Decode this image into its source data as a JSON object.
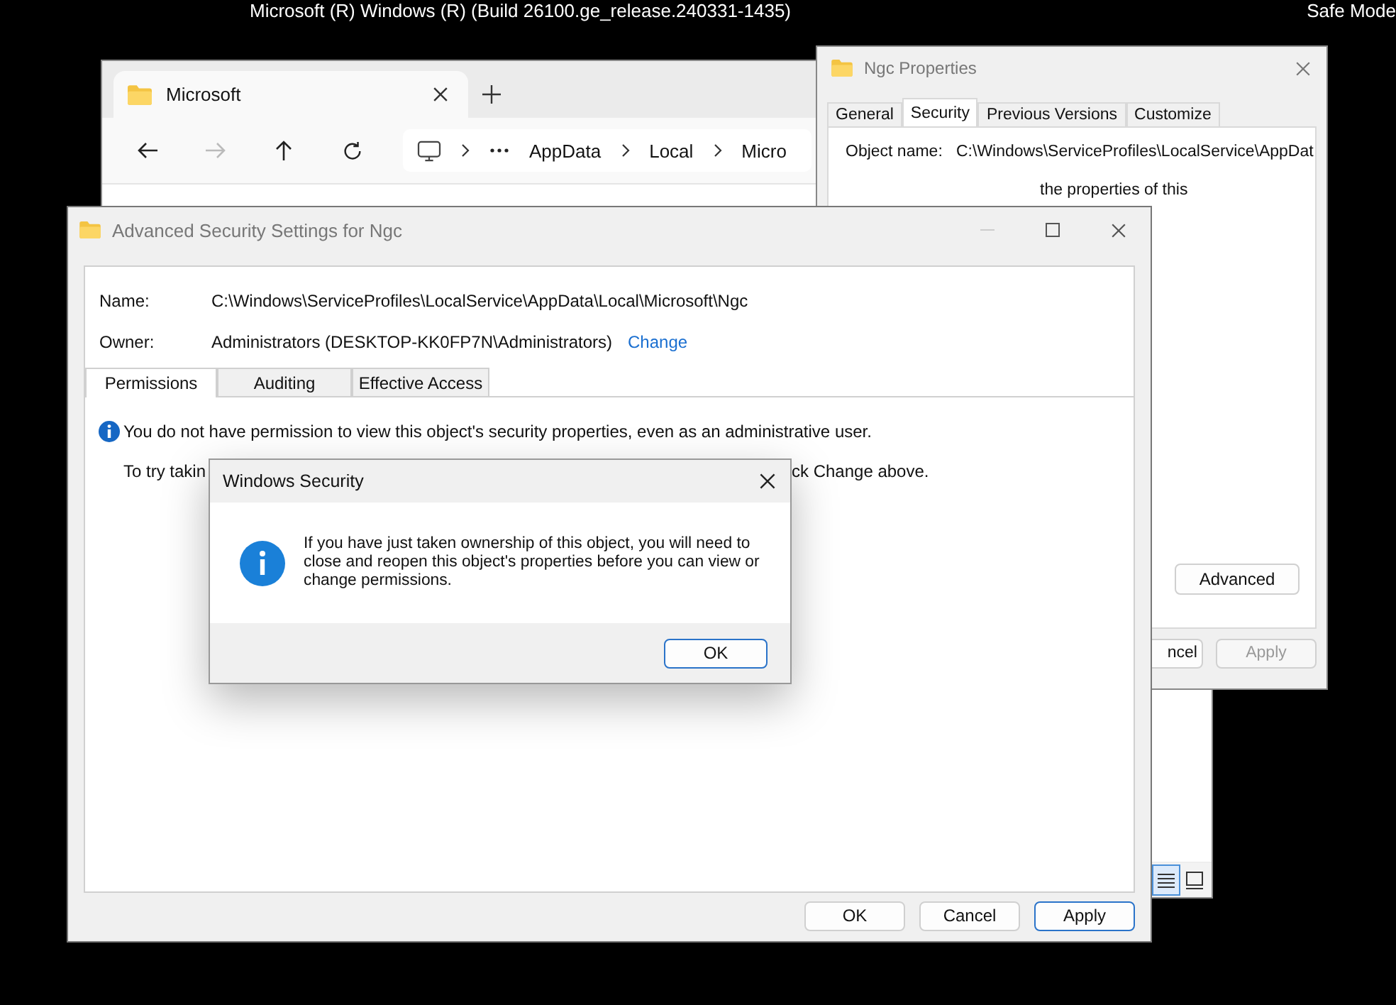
{
  "desktop": {
    "build_text": "Microsoft (R) Windows (R) (Build 26100.ge_release.240331-1435)",
    "mode_text": "Safe Mode"
  },
  "explorer": {
    "tabs": [
      {
        "label": "Microsoft",
        "selected": true
      }
    ],
    "nav": [
      {
        "kind": "back",
        "disabled": false
      },
      {
        "kind": "forward",
        "disabled": true
      },
      {
        "kind": "up",
        "disabled": false
      },
      {
        "kind": "refresh",
        "disabled": false
      }
    ],
    "breadcrumb": [
      "AppData",
      "Local",
      "Micro"
    ],
    "views": [
      {
        "kind": "details",
        "selected": true
      },
      {
        "kind": "tiles",
        "selected": false
      }
    ]
  },
  "properties": {
    "title": "Ngc Properties",
    "tabs": [
      {
        "label": "General",
        "selected": false
      },
      {
        "label": "Security",
        "selected": true
      },
      {
        "label": "Previous Versions",
        "selected": false
      },
      {
        "label": "Customize",
        "selected": false
      }
    ],
    "object_label": "Object name:",
    "object_value": "C:\\Windows\\ServiceProfiles\\LocalService\\AppDat",
    "notice": "the properties of this",
    "advanced_button": "Advanced",
    "buttons": [
      {
        "label": "ncel",
        "disabled": false
      },
      {
        "label": "Apply",
        "disabled": true
      }
    ]
  },
  "advanced": {
    "title": "Advanced Security Settings for Ngc",
    "name_label": "Name:",
    "name_value": "C:\\Windows\\ServiceProfiles\\LocalService\\AppData\\Local\\Microsoft\\Ngc",
    "owner_label": "Owner:",
    "owner_value": "Administrators (DESKTOP-KK0FP7N\\Administrators)",
    "change_link": "Change",
    "tabs": [
      {
        "label": "Permissions",
        "selected": true
      },
      {
        "label": "Auditing",
        "selected": false
      },
      {
        "label": "Effective Access",
        "selected": false
      }
    ],
    "notice": "You do not have permission to view this object's security properties, even as an administrative user.",
    "hint_fragments": [
      "To try takin",
      "ck Change above."
    ],
    "buttons": [
      {
        "label": "OK",
        "focused": false
      },
      {
        "label": "Cancel",
        "focused": false
      },
      {
        "label": "Apply",
        "focused": true
      }
    ]
  },
  "dialog": {
    "title": "Windows Security",
    "message": "If you have just taken ownership of this object, you will need to close and reopen this object's properties before you can view or change permissions.",
    "buttons": [
      {
        "label": "OK",
        "focused": true
      }
    ]
  }
}
